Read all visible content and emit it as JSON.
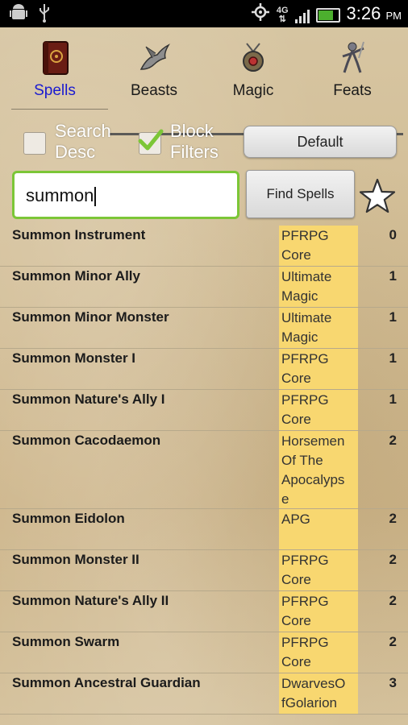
{
  "status_bar": {
    "time": "3:26",
    "ampm": "PM",
    "network": "4G"
  },
  "tabs": [
    {
      "label": "Spells",
      "icon": "spellbook-icon",
      "active": true
    },
    {
      "label": "Beasts",
      "icon": "dragon-icon"
    },
    {
      "label": "Magic",
      "icon": "amulet-icon"
    },
    {
      "label": "Feats",
      "icon": "warrior-icon"
    }
  ],
  "filters": {
    "search_desc": {
      "label_line1": "Search",
      "label_line2": "Desc",
      "checked": false
    },
    "block_filters": {
      "label_line1": "Block",
      "label_line2": "Filters",
      "checked": true
    },
    "default_button": "Default"
  },
  "search": {
    "value": "summon",
    "button": "Find Spells",
    "favorite_icon": "star-icon"
  },
  "colors": {
    "source_highlight": "#f8d770",
    "active_tab": "#1a1ad0",
    "search_border": "#7cc637"
  },
  "spells": [
    {
      "name": "Summon Instrument",
      "source": [
        "PFRPG",
        "Core"
      ],
      "level": "0"
    },
    {
      "name": "Summon Minor Ally",
      "source": [
        "Ultimate",
        "Magic"
      ],
      "level": "1"
    },
    {
      "name": "Summon Minor Monster",
      "source": [
        "Ultimate",
        "Magic"
      ],
      "level": "1"
    },
    {
      "name": "Summon Monster I",
      "source": [
        "PFRPG",
        "Core"
      ],
      "level": "1"
    },
    {
      "name": "Summon Nature's Ally I",
      "source": [
        "PFRPG",
        "Core"
      ],
      "level": "1"
    },
    {
      "name": "Summon Cacodaemon",
      "source": [
        "Horsemen",
        " Of The",
        "Apocalyps",
        "e"
      ],
      "level": "2"
    },
    {
      "name": "Summon Eidolon",
      "source": [
        "APG"
      ],
      "level": "2"
    },
    {
      "name": "Summon Monster II",
      "source": [
        "PFRPG",
        "Core"
      ],
      "level": "2"
    },
    {
      "name": "Summon Nature's Ally II",
      "source": [
        "PFRPG",
        "Core"
      ],
      "level": "2"
    },
    {
      "name": "Summon Swarm",
      "source": [
        "PFRPG",
        "Core"
      ],
      "level": "2"
    },
    {
      "name": "Summon Ancestral Guardian",
      "source": [
        "DwarvesO",
        "fGolarion"
      ],
      "level": "3"
    }
  ]
}
